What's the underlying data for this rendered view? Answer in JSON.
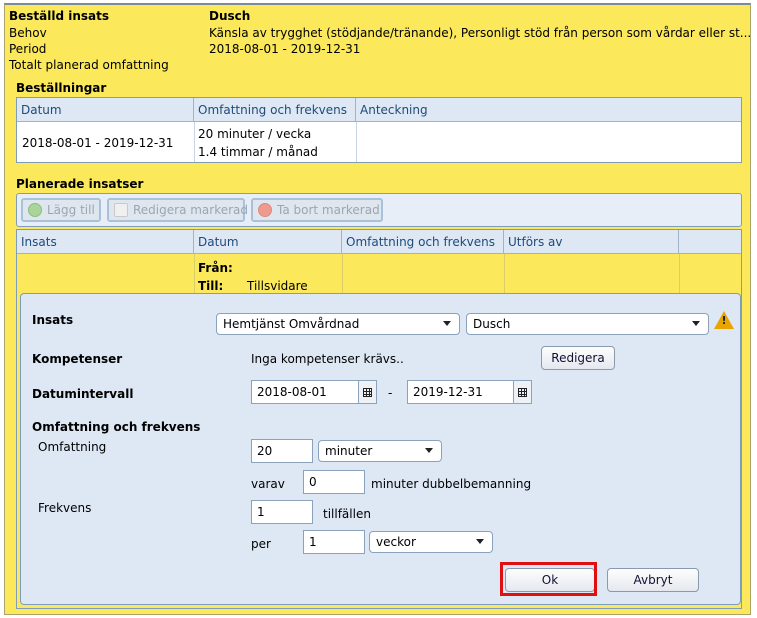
{
  "summary": {
    "insats_label": "Beställd insats",
    "insats_value": "Dusch",
    "behov_label": "Behov",
    "behov_value": "Känsla av trygghet (stödjande/tränande), Personligt stöd från person som vårdar eller st...",
    "period_label": "Period",
    "period_value": "2018-08-01  -  2019-12-31",
    "omfattning_label": "Totalt planerad omfattning"
  },
  "orders": {
    "title": "Beställningar",
    "columns": [
      "Datum",
      "Omfattning och frekvens",
      "Anteckning"
    ],
    "row": {
      "datum": "2018-08-01 - 2019-12-31",
      "omfattning_line1": "20 minuter / vecka",
      "omfattning_line2": "1.4 timmar / månad",
      "anteckning": ""
    }
  },
  "planned": {
    "title": "Planerade insatser",
    "toolbar": {
      "add": "Lägg till",
      "edit": "Redigera markerad",
      "remove": "Ta bort markerad"
    },
    "columns": [
      "Insats",
      "Datum",
      "Omfattning och frekvens",
      "Utförs av"
    ],
    "row": {
      "from_label": "Från:",
      "to_label": "Till:",
      "to_value": "Tillsvidare"
    }
  },
  "form": {
    "insats_label": "Insats",
    "insats_select": "Hemtjänst Omvårdnad",
    "insats_sub_select": "Dusch",
    "kompetenser_label": "Kompetenser",
    "kompetenser_value": "Inga kompetenser krävs..",
    "edit_button": "Redigera",
    "datum_label": "Datumintervall",
    "date_from": "2018-08-01",
    "date_sep": "-",
    "date_to": "2019-12-31",
    "omf_section": "Omfattning och frekvens",
    "omf_label": "Omfattning",
    "omf_value": "20",
    "omf_unit": "minuter",
    "varav_label": "varav",
    "varav_value": "0",
    "varav_suffix": "minuter  dubbelbemanning",
    "frekvens_label": "Frekvens",
    "frekvens_value": "1",
    "frekvens_suffix": "tillfällen",
    "per_label": "per",
    "per_value": "1",
    "per_unit": "veckor",
    "ok_button": "Ok",
    "cancel_button": "Avbryt"
  },
  "icons": {
    "warning": "warning-icon",
    "add": "plus-circle-icon",
    "edit": "pencil-icon",
    "remove": "minus-circle-icon",
    "calendar": "calendar-icon",
    "dropdown": "chevron-down-icon"
  },
  "colors": {
    "background": "#fbe95b",
    "panel": "#dde8f4",
    "highlight": "#e01010"
  }
}
